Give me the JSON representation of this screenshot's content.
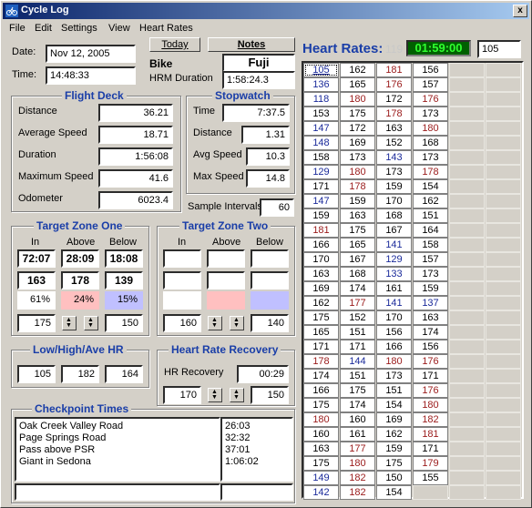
{
  "window": {
    "title": "Cycle Log",
    "close_symbol": "x"
  },
  "menu": [
    "File",
    "Edit",
    "Settings",
    "View",
    "Heart Rates"
  ],
  "date": {
    "label": "Date:",
    "value": "Nov 12, 2005"
  },
  "time": {
    "label": "Time:",
    "value": "14:48:33"
  },
  "today_button": "Today",
  "notes_tab": "Notes",
  "bike": {
    "label": "Bike",
    "value": "Fuji"
  },
  "hrm_duration": {
    "label": "HRM Duration",
    "value": "1:58:24.3"
  },
  "flight_deck": {
    "title": "Flight Deck",
    "rows": [
      {
        "label": "Distance",
        "value": "36.21"
      },
      {
        "label": "Average Speed",
        "value": "18.71"
      },
      {
        "label": "Duration",
        "value": "1:56:08"
      },
      {
        "label": "Maximum Speed",
        "value": "41.6"
      },
      {
        "label": "Odometer",
        "value": "6023.4"
      }
    ]
  },
  "stopwatch": {
    "title": "Stopwatch",
    "rows": [
      {
        "label": "Time",
        "value": "7:37.5"
      },
      {
        "label": "Distance",
        "value": "1.31"
      },
      {
        "label": "Avg Speed",
        "value": "10.3"
      },
      {
        "label": "Max Speed",
        "value": "14.8"
      }
    ]
  },
  "sample_intervals": {
    "label": "Sample Intervals",
    "value": "60"
  },
  "target_zone_one": {
    "title": "Target Zone One",
    "headers": [
      "In",
      "Above",
      "Below"
    ],
    "times": [
      "72:07",
      "28:09",
      "18:08"
    ],
    "counts": [
      "163",
      "178",
      "139"
    ],
    "pcts": [
      "61%",
      "24%",
      "15%"
    ],
    "low": "175",
    "high": "150",
    "colors": {
      "in": "#ffffff",
      "above": "#ffc0c0",
      "below": "#c0c0ff"
    }
  },
  "target_zone_two": {
    "title": "Target Zone Two",
    "headers": [
      "In",
      "Above",
      "Below"
    ],
    "times": [
      "",
      "",
      ""
    ],
    "counts": [
      "",
      "",
      ""
    ],
    "pcts": [
      "",
      "",
      ""
    ],
    "low": "160",
    "high": "140"
  },
  "low_high_ave": {
    "title": "Low/High/Ave HR",
    "values": [
      "105",
      "182",
      "164"
    ]
  },
  "hr_recovery": {
    "title": "Heart Rate Recovery",
    "label": "HR Recovery",
    "value": "00:29",
    "low": "170",
    "high": "150"
  },
  "checkpoints": {
    "title": "Checkpoint Times",
    "items": [
      {
        "name": "Oak Creek Valley Road",
        "time": "26:03"
      },
      {
        "name": "Page Springs Road",
        "time": "32:32"
      },
      {
        "name": "Pass above PSR",
        "time": "37:01"
      },
      {
        "name": "Giant in Sedona",
        "time": "1:06:02"
      }
    ]
  },
  "heart_rates": {
    "title": "Heart Rates:",
    "count": "119",
    "timer": "01:59:00",
    "value": "105",
    "colors": {
      "normal": "#000000",
      "low": "#1a2a9a",
      "high": "#9a1a1a",
      "timer_bg": "#006000",
      "timer_fg": "#30ff30"
    },
    "rows": [
      [
        {
          "v": "105",
          "c": "low",
          "sel": true
        },
        {
          "v": "162",
          "c": "normal"
        },
        {
          "v": "181",
          "c": "high"
        },
        {
          "v": "156",
          "c": "normal"
        }
      ],
      [
        {
          "v": "136",
          "c": "low"
        },
        {
          "v": "165",
          "c": "normal"
        },
        {
          "v": "176",
          "c": "high"
        },
        {
          "v": "157",
          "c": "normal"
        }
      ],
      [
        {
          "v": "118",
          "c": "low"
        },
        {
          "v": "180",
          "c": "high"
        },
        {
          "v": "172",
          "c": "normal"
        },
        {
          "v": "176",
          "c": "high"
        }
      ],
      [
        {
          "v": "153",
          "c": "normal"
        },
        {
          "v": "175",
          "c": "normal"
        },
        {
          "v": "178",
          "c": "high"
        },
        {
          "v": "173",
          "c": "normal"
        }
      ],
      [
        {
          "v": "147",
          "c": "low"
        },
        {
          "v": "172",
          "c": "normal"
        },
        {
          "v": "163",
          "c": "normal"
        },
        {
          "v": "180",
          "c": "high"
        }
      ],
      [
        {
          "v": "148",
          "c": "low"
        },
        {
          "v": "169",
          "c": "normal"
        },
        {
          "v": "152",
          "c": "normal"
        },
        {
          "v": "168",
          "c": "normal"
        }
      ],
      [
        {
          "v": "158",
          "c": "normal"
        },
        {
          "v": "173",
          "c": "normal"
        },
        {
          "v": "143",
          "c": "low"
        },
        {
          "v": "173",
          "c": "normal"
        }
      ],
      [
        {
          "v": "129",
          "c": "low"
        },
        {
          "v": "180",
          "c": "high"
        },
        {
          "v": "173",
          "c": "normal"
        },
        {
          "v": "178",
          "c": "high"
        }
      ],
      [
        {
          "v": "171",
          "c": "normal"
        },
        {
          "v": "178",
          "c": "high"
        },
        {
          "v": "159",
          "c": "normal"
        },
        {
          "v": "154",
          "c": "normal"
        }
      ],
      [
        {
          "v": "147",
          "c": "low"
        },
        {
          "v": "159",
          "c": "normal"
        },
        {
          "v": "170",
          "c": "normal"
        },
        {
          "v": "162",
          "c": "normal"
        }
      ],
      [
        {
          "v": "159",
          "c": "normal"
        },
        {
          "v": "163",
          "c": "normal"
        },
        {
          "v": "168",
          "c": "normal"
        },
        {
          "v": "151",
          "c": "normal"
        }
      ],
      [
        {
          "v": "181",
          "c": "high"
        },
        {
          "v": "175",
          "c": "normal"
        },
        {
          "v": "167",
          "c": "normal"
        },
        {
          "v": "164",
          "c": "normal"
        }
      ],
      [
        {
          "v": "166",
          "c": "normal"
        },
        {
          "v": "165",
          "c": "normal"
        },
        {
          "v": "141",
          "c": "low"
        },
        {
          "v": "158",
          "c": "normal"
        }
      ],
      [
        {
          "v": "170",
          "c": "normal"
        },
        {
          "v": "167",
          "c": "normal"
        },
        {
          "v": "129",
          "c": "low"
        },
        {
          "v": "157",
          "c": "normal"
        }
      ],
      [
        {
          "v": "163",
          "c": "normal"
        },
        {
          "v": "168",
          "c": "normal"
        },
        {
          "v": "133",
          "c": "low"
        },
        {
          "v": "173",
          "c": "normal"
        }
      ],
      [
        {
          "v": "169",
          "c": "normal"
        },
        {
          "v": "174",
          "c": "normal"
        },
        {
          "v": "161",
          "c": "normal"
        },
        {
          "v": "159",
          "c": "normal"
        }
      ],
      [
        {
          "v": "162",
          "c": "normal"
        },
        {
          "v": "177",
          "c": "high"
        },
        {
          "v": "141",
          "c": "low"
        },
        {
          "v": "137",
          "c": "low"
        }
      ],
      [
        {
          "v": "175",
          "c": "normal"
        },
        {
          "v": "152",
          "c": "normal"
        },
        {
          "v": "170",
          "c": "normal"
        },
        {
          "v": "163",
          "c": "normal"
        }
      ],
      [
        {
          "v": "165",
          "c": "normal"
        },
        {
          "v": "151",
          "c": "normal"
        },
        {
          "v": "156",
          "c": "normal"
        },
        {
          "v": "174",
          "c": "normal"
        }
      ],
      [
        {
          "v": "171",
          "c": "normal"
        },
        {
          "v": "171",
          "c": "normal"
        },
        {
          "v": "166",
          "c": "normal"
        },
        {
          "v": "156",
          "c": "normal"
        }
      ],
      [
        {
          "v": "178",
          "c": "high"
        },
        {
          "v": "144",
          "c": "low"
        },
        {
          "v": "180",
          "c": "high"
        },
        {
          "v": "176",
          "c": "high"
        }
      ],
      [
        {
          "v": "174",
          "c": "normal"
        },
        {
          "v": "151",
          "c": "normal"
        },
        {
          "v": "173",
          "c": "normal"
        },
        {
          "v": "171",
          "c": "normal"
        }
      ],
      [
        {
          "v": "166",
          "c": "normal"
        },
        {
          "v": "175",
          "c": "normal"
        },
        {
          "v": "151",
          "c": "normal"
        },
        {
          "v": "176",
          "c": "high"
        }
      ],
      [
        {
          "v": "175",
          "c": "normal"
        },
        {
          "v": "174",
          "c": "normal"
        },
        {
          "v": "154",
          "c": "normal"
        },
        {
          "v": "180",
          "c": "high"
        }
      ],
      [
        {
          "v": "180",
          "c": "high"
        },
        {
          "v": "160",
          "c": "normal"
        },
        {
          "v": "169",
          "c": "normal"
        },
        {
          "v": "182",
          "c": "high"
        }
      ],
      [
        {
          "v": "160",
          "c": "normal"
        },
        {
          "v": "161",
          "c": "normal"
        },
        {
          "v": "162",
          "c": "normal"
        },
        {
          "v": "181",
          "c": "high"
        }
      ],
      [
        {
          "v": "163",
          "c": "normal"
        },
        {
          "v": "177",
          "c": "high"
        },
        {
          "v": "159",
          "c": "normal"
        },
        {
          "v": "171",
          "c": "normal"
        }
      ],
      [
        {
          "v": "175",
          "c": "normal"
        },
        {
          "v": "180",
          "c": "high"
        },
        {
          "v": "175",
          "c": "normal"
        },
        {
          "v": "179",
          "c": "high"
        }
      ],
      [
        {
          "v": "149",
          "c": "low"
        },
        {
          "v": "182",
          "c": "high"
        },
        {
          "v": "150",
          "c": "normal"
        },
        {
          "v": "155",
          "c": "normal"
        }
      ],
      [
        {
          "v": "142",
          "c": "low"
        },
        {
          "v": "182",
          "c": "high"
        },
        {
          "v": "154",
          "c": "normal"
        },
        {
          "v": "",
          "c": "blank"
        }
      ]
    ]
  }
}
